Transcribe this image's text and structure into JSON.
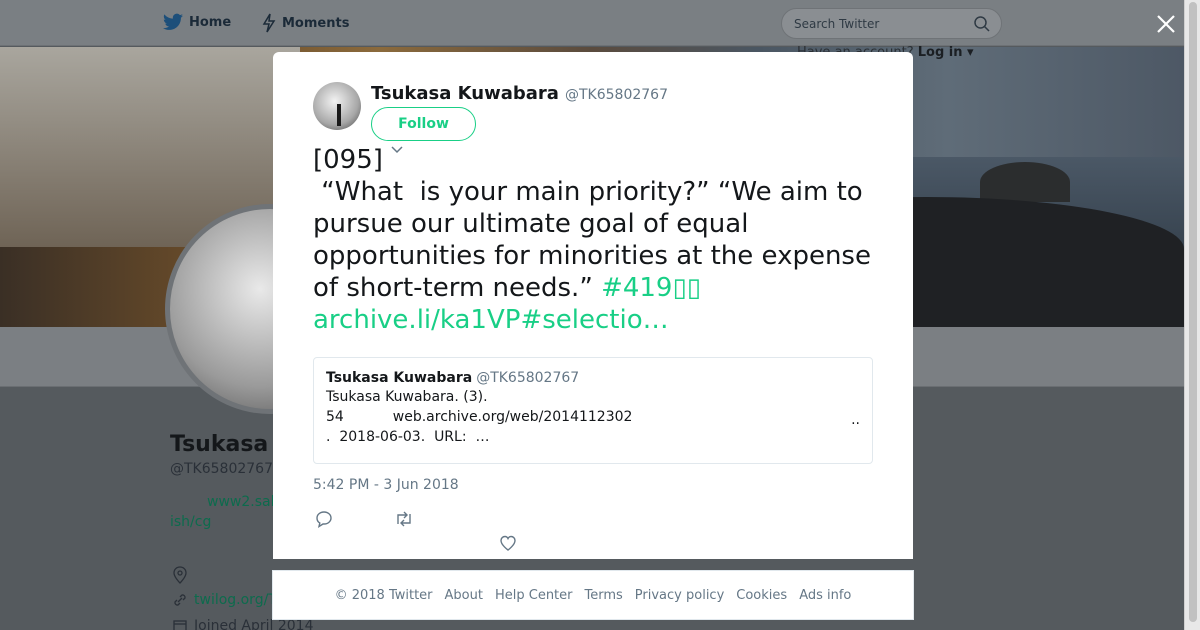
{
  "background": {
    "nav": {
      "home_label": "Home",
      "moments_label": "Moments"
    },
    "search": {
      "placeholder": "Search Twitter"
    },
    "have_account": {
      "text": "Have an account?",
      "login": "Log in"
    },
    "profile": {
      "name": "Tsukasa",
      "handle": "@TK65802767",
      "bio_line1": "www2.sal",
      "bio_line2": "ish/cg",
      "link": "twilog.org/T",
      "joined": "Joined April 2014"
    }
  },
  "tweet": {
    "author_name": "Tsukasa Kuwabara",
    "author_handle": "@TK65802767",
    "follow_label": "Follow",
    "text_main": "[095]\n “What  is your main priority?” “We aim to pursue our ultimate goal of equal opportunities for minorities at the expense of short-term needs.” ",
    "hashtag": "#419▯▯",
    "link": "archive.li/ka1VP#selectio…",
    "quote": {
      "name": "Tsukasa Kuwabara",
      "handle": "@TK65802767",
      "line1": "Tsukasa Kuwabara. (3).",
      "line2": "54           web.archive.org/web/2014112302",
      "line2_end": "..",
      "line3": ".  2018-06-03.  URL:  …"
    },
    "timestamp": "5:42 PM - 3 Jun 2018"
  },
  "footer": {
    "copyright": "© 2018 Twitter",
    "links": [
      "About",
      "Help Center",
      "Terms",
      "Privacy policy",
      "Cookies",
      "Ads info"
    ]
  },
  "colors": {
    "accent": "#19cf86",
    "muted": "#657786",
    "text": "#14171a"
  }
}
